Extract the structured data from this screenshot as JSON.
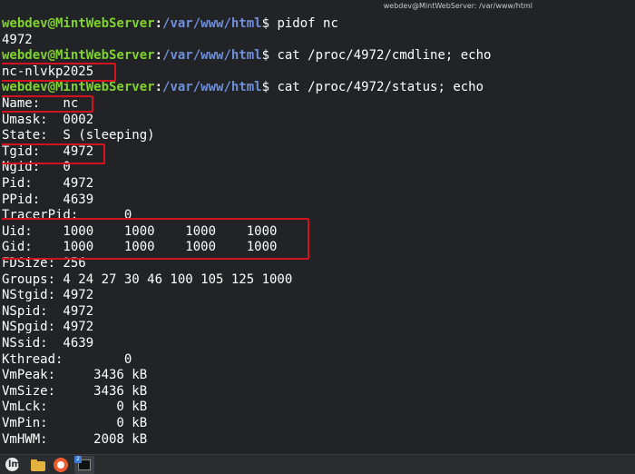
{
  "window": {
    "title": "webdev@MintWebServer: /var/www/html"
  },
  "prompt": {
    "user_host": "webdev@MintWebServer",
    "sep": ":",
    "path": "/var/www/html",
    "symbol": "$ "
  },
  "commands": [
    "pidof nc",
    "cat /proc/4972/cmdline; echo",
    "cat /proc/4972/status; echo"
  ],
  "outputs": {
    "pid": "4972",
    "cmdline": "nc-nlvkp2025"
  },
  "status_lines": [
    "Name:   nc",
    "Umask:  0002",
    "State:  S (sleeping)",
    "Tgid:   4972",
    "Ngid:   0",
    "Pid:    4972",
    "PPid:   4639",
    "TracerPid:      0",
    "Uid:    1000    1000    1000    1000",
    "Gid:    1000    1000    1000    1000",
    "FDSize: 256",
    "Groups: 4 24 27 30 46 100 105 125 1000",
    "NStgid: 4972",
    "NSpid:  4972",
    "NSpgid: 4972",
    "NSsid:  4639",
    "Kthread:        0",
    "VmPeak:     3436 kB",
    "VmSize:     3436 kB",
    "VmLck:         0 kB",
    "VmPin:         0 kB",
    "VmHWM:      2008 kB"
  ],
  "taskbar": {
    "menu_icon": "linux-mint-menu-icon",
    "files_icon": "folder-icon",
    "browser_icon": "browser-icon",
    "terminal_icon": "terminal-icon",
    "terminal_badge": "2"
  },
  "colors": {
    "background": "#222327",
    "prompt_user": "#7fd32b",
    "prompt_path": "#6f8fd8",
    "highlight": "#d3121f"
  }
}
